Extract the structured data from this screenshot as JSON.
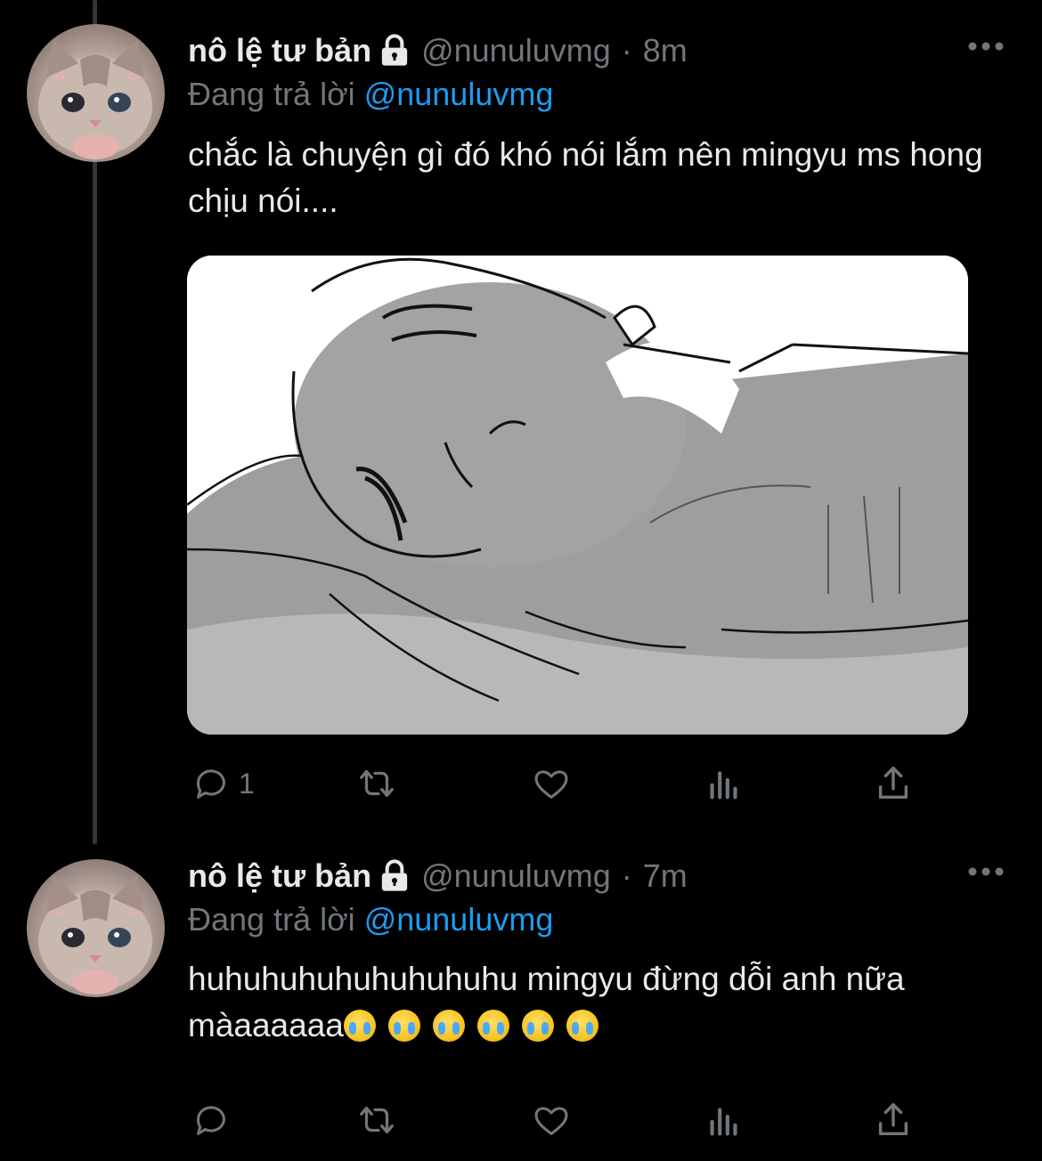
{
  "colors": {
    "background": "#000000",
    "primary_text": "#e7e9ea",
    "secondary_text": "#71767b",
    "link": "#1d9bf0",
    "thread_line": "#333639"
  },
  "tweets": [
    {
      "display_name": "nô lệ tư bản",
      "handle": "@nunuluvmg",
      "separator": "·",
      "time": "8m",
      "reply_label": "Đang trả lời",
      "reply_to": "@nunuluvmg",
      "text": "chắc là chuyện gì đó khó nói lắm nên mingyu ms hong chịu nói....",
      "has_media": true,
      "media_icon": "sketch-image",
      "reply_count": "1",
      "icons": [
        "lock-icon",
        "more-icon",
        "reply-icon",
        "retweet-icon",
        "like-icon",
        "views-icon",
        "share-icon"
      ]
    },
    {
      "display_name": "nô lệ tư bản",
      "handle": "@nunuluvmg",
      "separator": "·",
      "time": "7m",
      "reply_label": "Đang trả lời",
      "reply_to": "@nunuluvmg",
      "text": "huhuhuhuhuhuhuhuhu mingyu đừng dỗi anh nữa màaaaaaa",
      "emoji_name": "loudly-crying-face-icon",
      "emoji_count": 6,
      "has_media": false,
      "reply_count": "",
      "icons": [
        "lock-icon",
        "more-icon",
        "reply-icon",
        "retweet-icon",
        "like-icon",
        "views-icon",
        "share-icon"
      ]
    }
  ]
}
